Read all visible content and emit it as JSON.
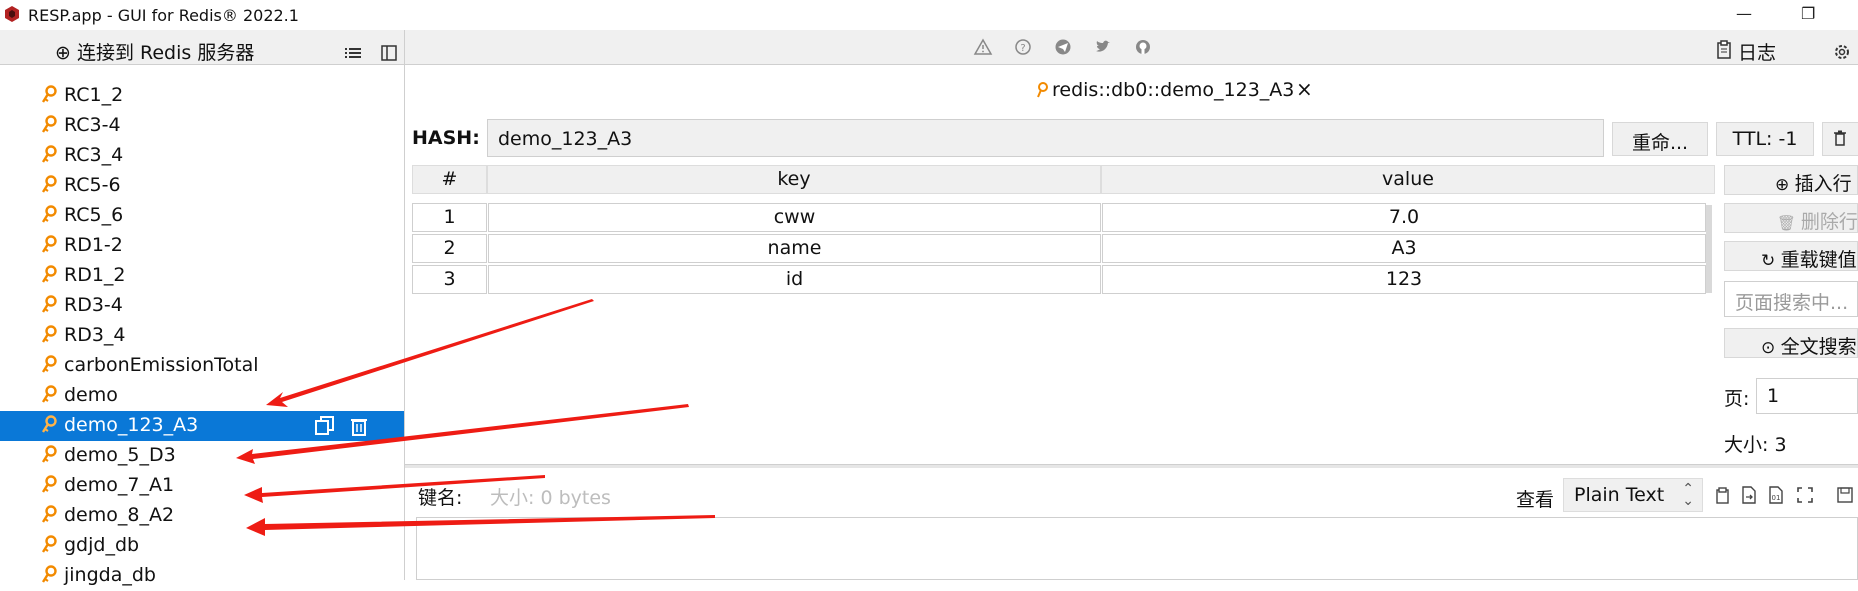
{
  "window": {
    "title": "RESP.app - GUI for Redis® 2022.1",
    "minimize_glyph": "—",
    "restore_glyph": "❐"
  },
  "sidebar": {
    "connect_label": "⊕ 连接到 Redis 服务器",
    "keys": [
      {
        "name": "RC1_2"
      },
      {
        "name": "RC3-4"
      },
      {
        "name": "RC3_4"
      },
      {
        "name": "RC5-6"
      },
      {
        "name": "RC5_6"
      },
      {
        "name": "RD1-2"
      },
      {
        "name": "RD1_2"
      },
      {
        "name": "RD3-4"
      },
      {
        "name": "RD3_4"
      },
      {
        "name": "carbonEmissionTotal"
      },
      {
        "name": "demo"
      },
      {
        "name": "demo_123_A3",
        "selected": true
      },
      {
        "name": "demo_5_D3"
      },
      {
        "name": "demo_7_A1"
      },
      {
        "name": "demo_8_A2"
      },
      {
        "name": "gdjd_db"
      },
      {
        "name": "jingda_db"
      }
    ]
  },
  "toolbar": {
    "icons": [
      "warning-icon",
      "help-icon",
      "telegram-icon",
      "twitter-icon",
      "github-icon"
    ],
    "log_label": "日志"
  },
  "tab": {
    "label": "redis::db0::demo_123_A3",
    "close": "×"
  },
  "key_view": {
    "type_label": "HASH:",
    "key_name": "demo_123_A3",
    "rename_label": "重命...",
    "ttl_label": "TTL:  -1",
    "columns": [
      "#",
      "key",
      "value"
    ],
    "rows": [
      {
        "index": "1",
        "key": "cww",
        "value": "7.0"
      },
      {
        "index": "2",
        "key": "name",
        "value": "A3"
      },
      {
        "index": "3",
        "key": "id",
        "value": "123"
      }
    ],
    "side": {
      "insert_label": "插入行",
      "delete_label": "删除行",
      "reload_label": "重载键值",
      "search_placeholder": "页面搜索中...",
      "fulltext_label": "全文搜索",
      "page_label": "页:",
      "page_value": "1",
      "size_label": "大小: 3"
    }
  },
  "value_editor": {
    "key_name_label": "键名:",
    "size_label": "大小: 0 bytes",
    "view_label": "查看",
    "format_value": "Plain Text"
  },
  "colors": {
    "selection": "#0a78d7",
    "key_icon": "#f28a00",
    "annotation_arrow": "#ee1c14"
  }
}
